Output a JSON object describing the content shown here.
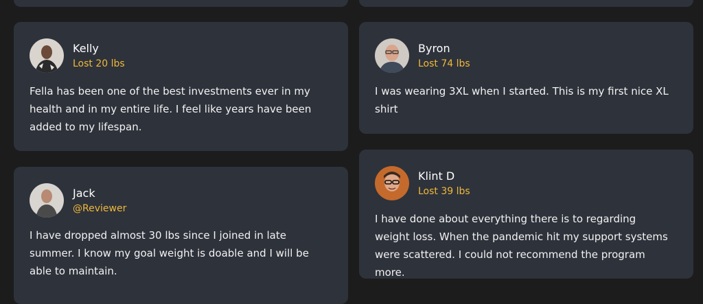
{
  "testimonials": [
    {
      "name": "Kelly",
      "subtitle": "Lost 20 lbs",
      "text": "Fella has been one of the best investments ever in my health and in my entire life. I feel like years have been added to my lifespan."
    },
    {
      "name": "Byron",
      "subtitle": "Lost 74 lbs",
      "text": "I was wearing 3XL when I started. This is my first nice XL shirt"
    },
    {
      "name": "Jack",
      "subtitle": "@Reviewer",
      "text": "I have dropped almost 30 lbs since I joined in late summer. I know my goal weight is doable and I will be able to maintain."
    },
    {
      "name": "Klint D",
      "subtitle": "Lost 39 lbs",
      "text": "I have done about everything there is to regarding weight loss. When the pandemic hit my support systems were scattered. I could not recommend the program more."
    }
  ],
  "colors": {
    "page_background": "#1c1c1c",
    "card_background": "#2e323b",
    "subtitle_accent": "#f0b93a",
    "name_text": "#ffffff",
    "body_text": "#f2f2f2"
  }
}
